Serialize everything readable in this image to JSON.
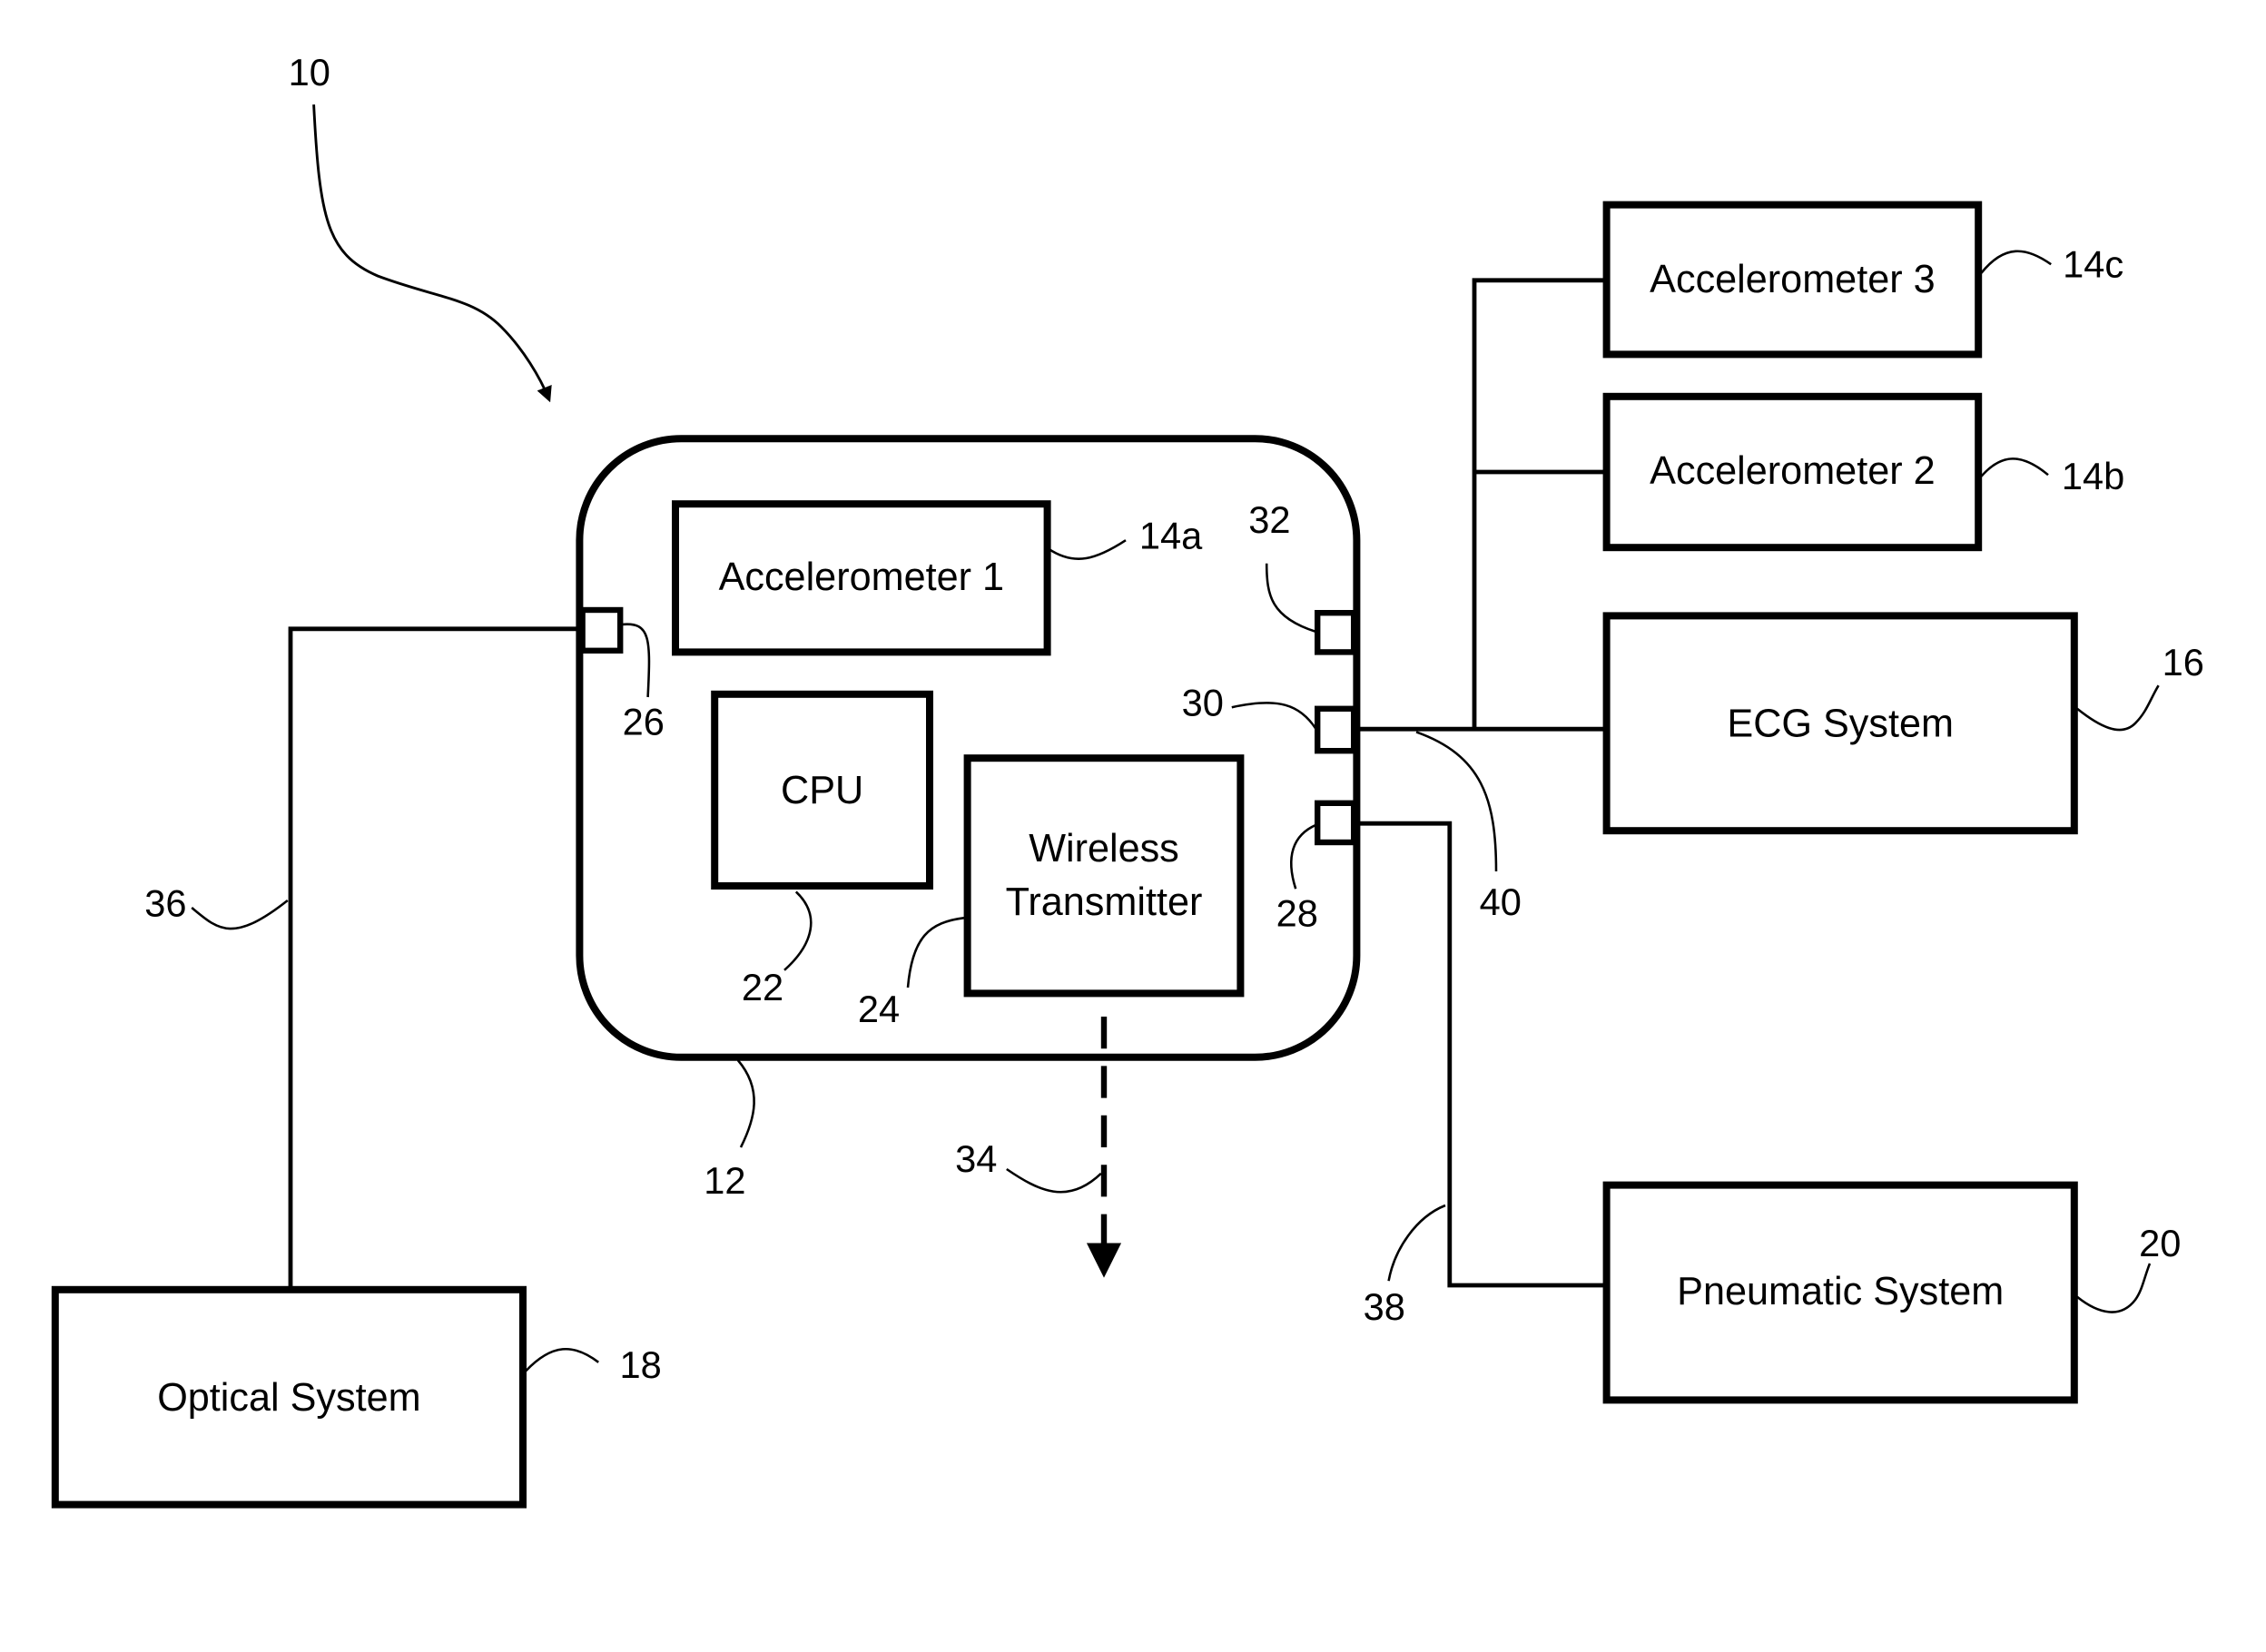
{
  "figure": {
    "system_ref": "10",
    "device": {
      "ref": "12"
    },
    "blocks": {
      "accelerometer1": {
        "label": "Accelerometer 1",
        "ref": "14a"
      },
      "accelerometer2": {
        "label": "Accelerometer 2",
        "ref": "14b"
      },
      "accelerometer3": {
        "label": "Accelerometer 3",
        "ref": "14c"
      },
      "ecg": {
        "label": "ECG System",
        "ref": "16"
      },
      "optical": {
        "label": "Optical System",
        "ref": "18"
      },
      "pneumatic": {
        "label": "Pneumatic System",
        "ref": "20"
      },
      "cpu": {
        "label": "CPU",
        "ref": "22"
      },
      "wireless": {
        "label_line1": "Wireless",
        "label_line2": "Transmitter",
        "ref": "24"
      }
    },
    "ports": {
      "port26": {
        "ref": "26"
      },
      "port28": {
        "ref": "28"
      },
      "port30": {
        "ref": "30"
      },
      "port32": {
        "ref": "32"
      }
    },
    "links": {
      "wireless_signal": {
        "ref": "34"
      },
      "optical_line": {
        "ref": "36"
      },
      "pneumatic_line": {
        "ref": "38"
      },
      "ecg_line": {
        "ref": "40"
      }
    }
  }
}
